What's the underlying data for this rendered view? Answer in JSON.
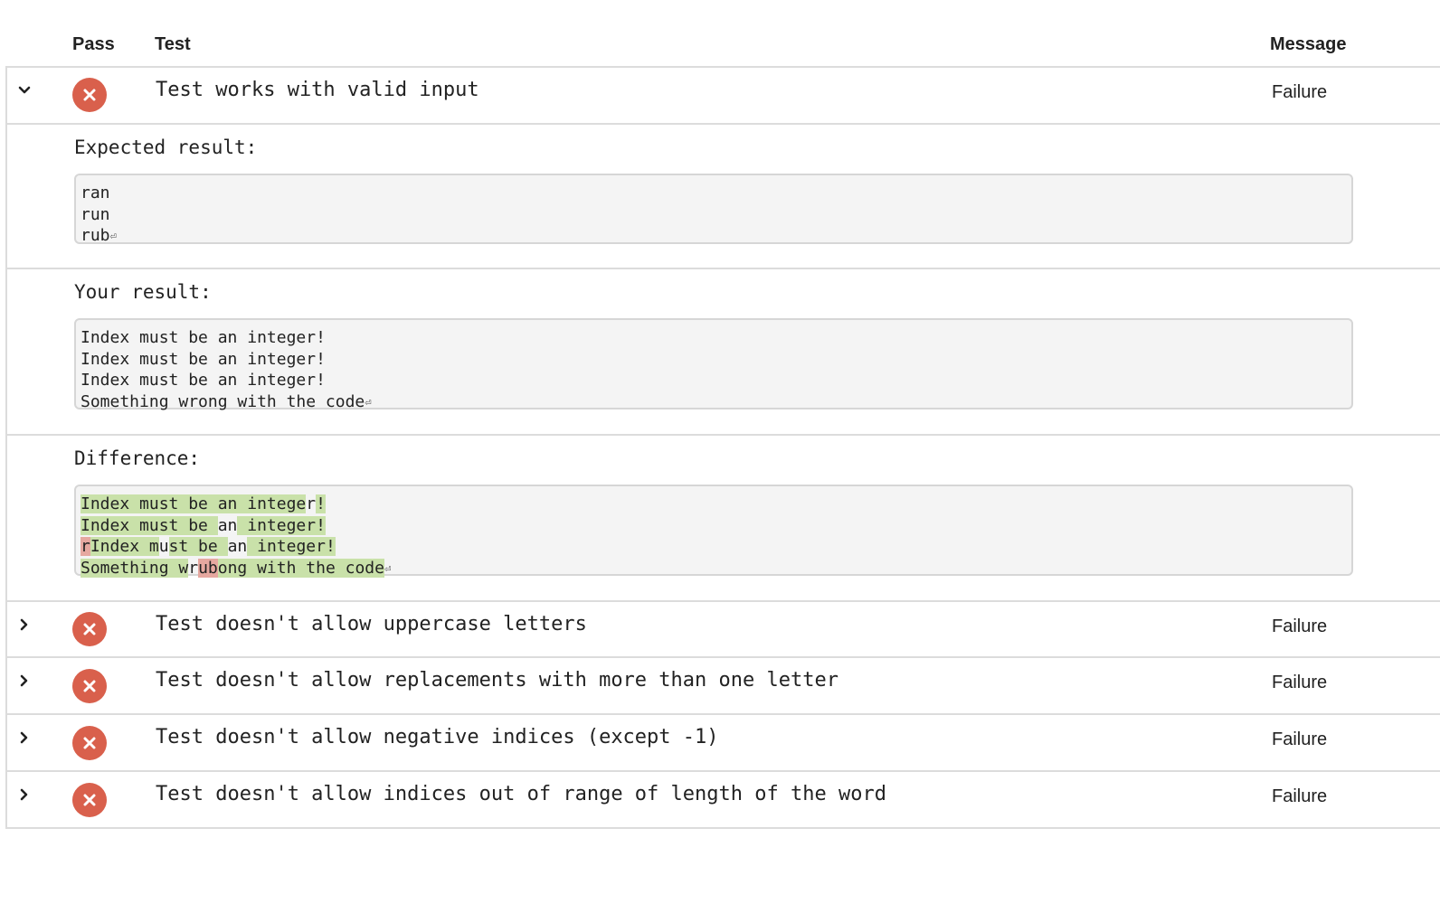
{
  "header": {
    "pass": "Pass",
    "test": "Test",
    "message": "Message"
  },
  "colors": {
    "failure": "#d9604c",
    "diff_added": "#c9e1a9",
    "diff_removed": "#e6a8a0"
  },
  "icons": {
    "expanded": "chevron-down-icon",
    "collapsed": "chevron-right-icon",
    "status": "failure-x-icon"
  },
  "expanded_test": {
    "name": "Test works with valid input",
    "message": "Failure",
    "expected_title": "Expected result:",
    "expected_lines": [
      "ran",
      "run",
      "rub"
    ],
    "actual_title": "Your result:",
    "actual_lines": [
      "Index must be an integer!",
      "Index must be an integer!",
      "Index must be an integer!",
      "Something wrong with the code"
    ],
    "diff_title": "Difference:",
    "diff_lines": [
      {
        "segs": [
          {
            "t": "Index must be an intege",
            "c": "g"
          },
          {
            "t": "r",
            "c": ""
          },
          {
            "t": "!",
            "c": "g"
          }
        ]
      },
      {
        "segs": [
          {
            "t": "Index must be ",
            "c": "g"
          },
          {
            "t": "an",
            "c": ""
          },
          {
            "t": " integer!",
            "c": "g"
          }
        ]
      },
      {
        "segs": [
          {
            "t": "r",
            "c": "r"
          },
          {
            "t": "Index m",
            "c": "g"
          },
          {
            "t": "u",
            "c": ""
          },
          {
            "t": "st be ",
            "c": "g"
          },
          {
            "t": "an",
            "c": ""
          },
          {
            "t": " integer!",
            "c": "g"
          }
        ]
      },
      {
        "segs": [
          {
            "t": "Something w",
            "c": "g"
          },
          {
            "t": "r",
            "c": ""
          },
          {
            "t": "ub",
            "c": "r"
          },
          {
            "t": "ong with the code",
            "c": "g"
          }
        ]
      }
    ],
    "return_mark": "⏎"
  },
  "tests": [
    {
      "name": "Test doesn't allow uppercase letters",
      "message": "Failure"
    },
    {
      "name": "Test doesn't allow replacements with more than one letter",
      "message": "Failure"
    },
    {
      "name": "Test doesn't allow negative indices (except -1)",
      "message": "Failure"
    },
    {
      "name": "Test doesn't allow indices out of range of length of the word",
      "message": "Failure"
    }
  ]
}
